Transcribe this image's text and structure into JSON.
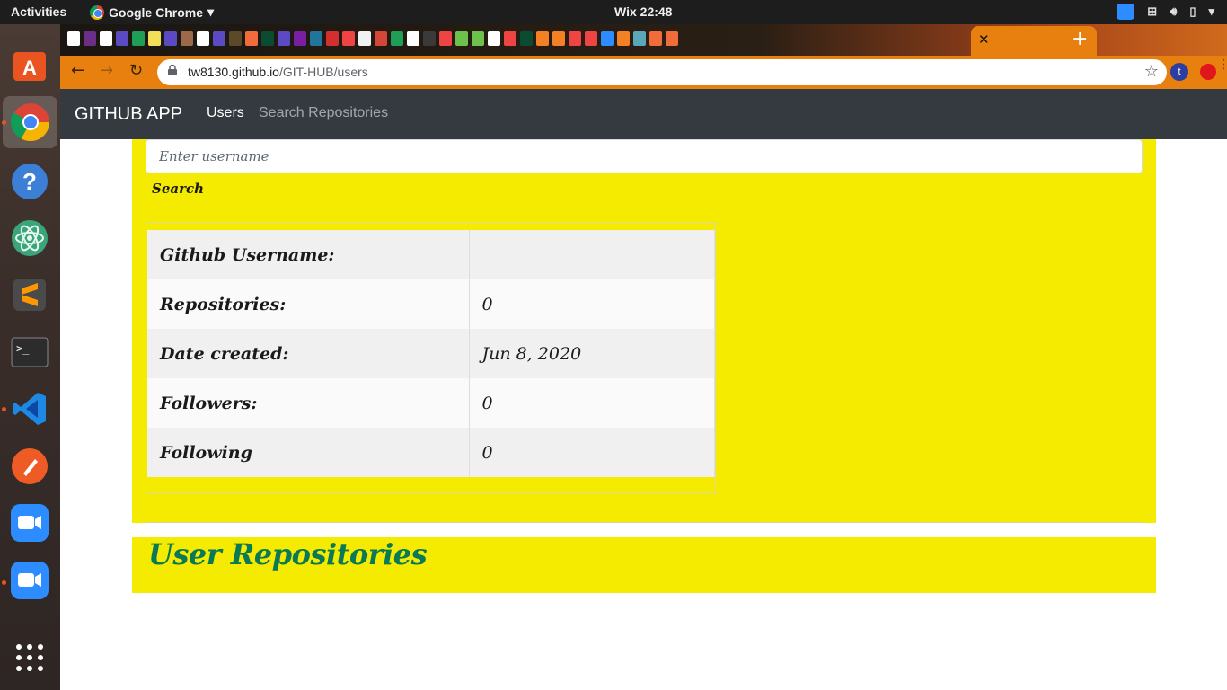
{
  "system_bar": {
    "activities": "Activities",
    "app_name": "Google Chrome",
    "clock": "Wix 22:48"
  },
  "browser": {
    "url_host": "tw8130.github.io",
    "url_path": "/GIT-HUB/users",
    "profile_initial": "t",
    "accent_color": "#e8800f"
  },
  "navbar": {
    "brand": "GITHUB APP",
    "links": [
      "Users",
      "Search Repositories"
    ],
    "background": "#343a40"
  },
  "search": {
    "placeholder": "Enter username",
    "value": "",
    "button_label": "Search"
  },
  "profile": {
    "rows": [
      {
        "label": "Github Username:",
        "value": ""
      },
      {
        "label": "Repositories:",
        "value": "0"
      },
      {
        "label": "Date created:",
        "value": "Jun 8, 2020"
      },
      {
        "label": "Followers:",
        "value": "0"
      },
      {
        "label": "Following",
        "value": "0"
      }
    ]
  },
  "repositories": {
    "heading": "User Repositories"
  },
  "theme": {
    "card_background": "#f5eb00",
    "heading_color": "#0a7a56"
  }
}
